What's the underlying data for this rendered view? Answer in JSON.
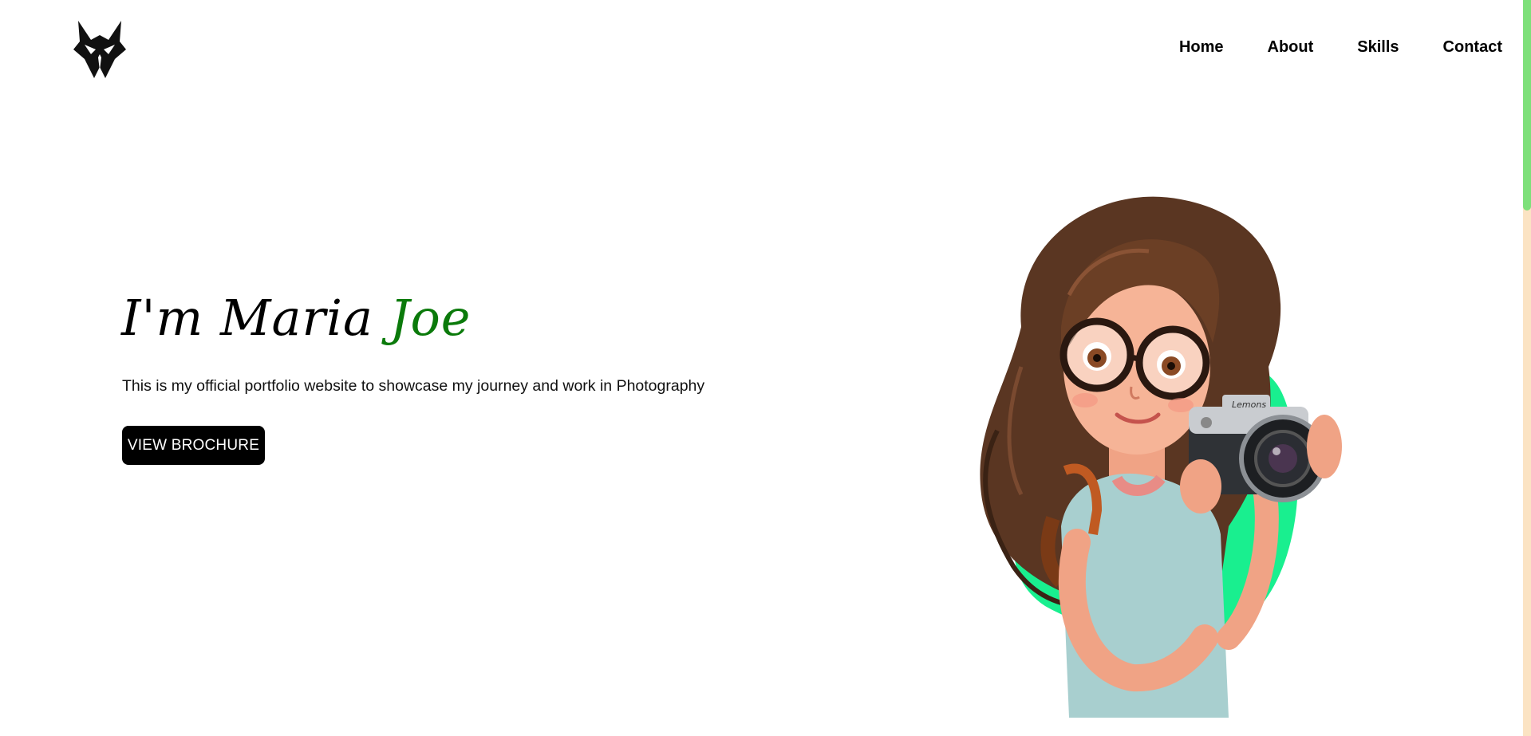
{
  "header": {
    "logo_icon": "fox-head-icon",
    "nav": [
      {
        "label": "Home"
      },
      {
        "label": "About"
      },
      {
        "label": "Skills"
      },
      {
        "label": "Contact"
      }
    ]
  },
  "hero": {
    "title_main": "I'm Maria ",
    "title_accent": "Joe",
    "subtitle": "This is my official portfolio website to showcase my journey and work in Photography",
    "cta_label": "VIEW BROCHURE",
    "illustration": {
      "icon": "girl-with-camera-illustration",
      "camera_brand": "Lemons"
    }
  },
  "colors": {
    "accent": "#0b7a0b",
    "blob": "#19ef8f",
    "button_bg": "#000000",
    "scroll_track": "#fbe3c3",
    "scroll_thumb": "#7ee07a"
  }
}
